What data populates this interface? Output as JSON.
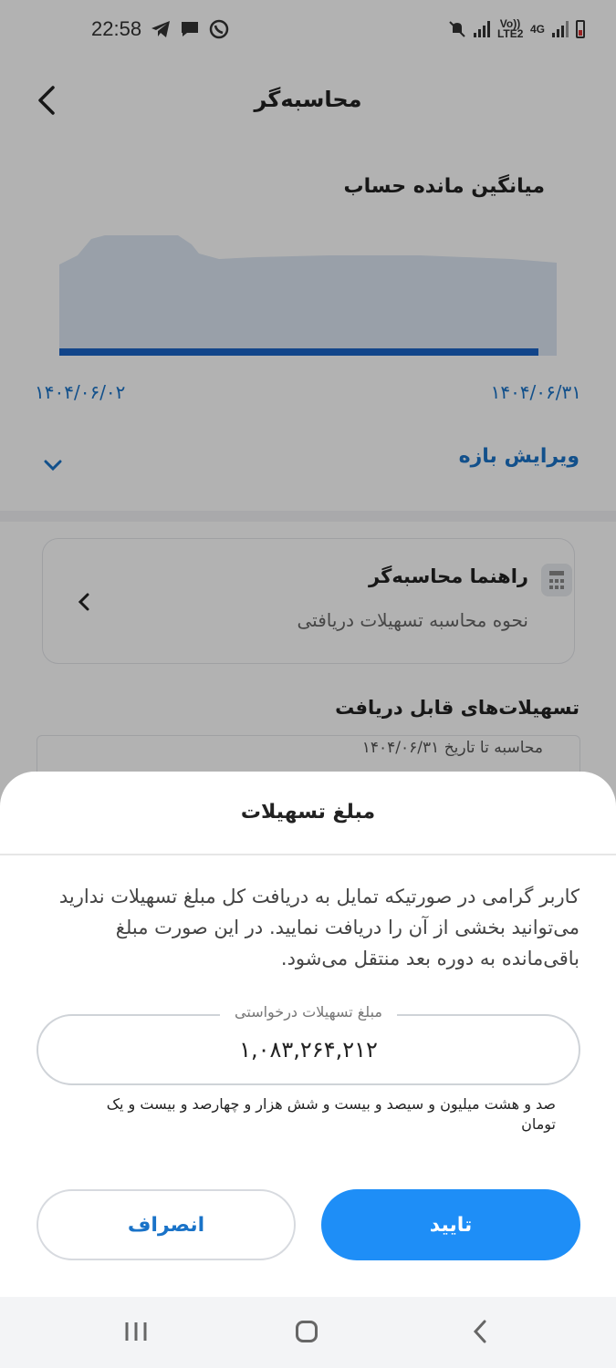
{
  "status_bar": {
    "time": "22:58",
    "icons": [
      "telegram-icon",
      "message-icon",
      "whatsapp-icon",
      "mute-icon",
      "signal-icon",
      "volte-icon",
      "4g-icon",
      "battery-icon"
    ],
    "volte_label": "Vo)) LTE2",
    "net_label": "4G"
  },
  "header": {
    "title": "محاسبه‌گر"
  },
  "chart_data": {
    "type": "area",
    "title": "میانگین مانده حساب",
    "x_start_label": "۱۴۰۴/۰۶/۰۲",
    "x_end_label": "۱۴۰۴/۰۶/۳۱",
    "colors": {
      "area": "#dbe6f2",
      "line": "#1a63c6"
    }
  },
  "range": {
    "label": "ویرایش بازه"
  },
  "guide": {
    "title": "راهنما محاسبه‌گر",
    "subtitle": "نحوه محاسبه تسهیلات دریافتی"
  },
  "facilities": {
    "title": "تسهیلات‌های قابل دریافت",
    "subtitle": "محاسبه تا تاریخ ۱۴۰۴/۰۶/۳۱"
  },
  "sheet": {
    "title": "مبلغ تسهیلات",
    "description": "کاربر گرامی در صورتیکه تمایل به دریافت کل مبلغ تسهیلات ندارید می‌توانید بخشی از آن را دریافت نمایید. در این صورت مبلغ باقی‌مانده به دوره بعد منتقل می‌شود.",
    "field_label": "مبلغ تسهیلات درخواستی",
    "field_value": "۱,۰۸۳,۲۶۴,۲۱۲",
    "amount_words": "صد و هشت میلیون و سیصد و بیست و شش هزار و چهارصد و بیست و یک تومان",
    "confirm_label": "تایید",
    "cancel_label": "انصراف"
  },
  "colors": {
    "accent": "#1e8ef7",
    "link": "#1a73c8"
  }
}
